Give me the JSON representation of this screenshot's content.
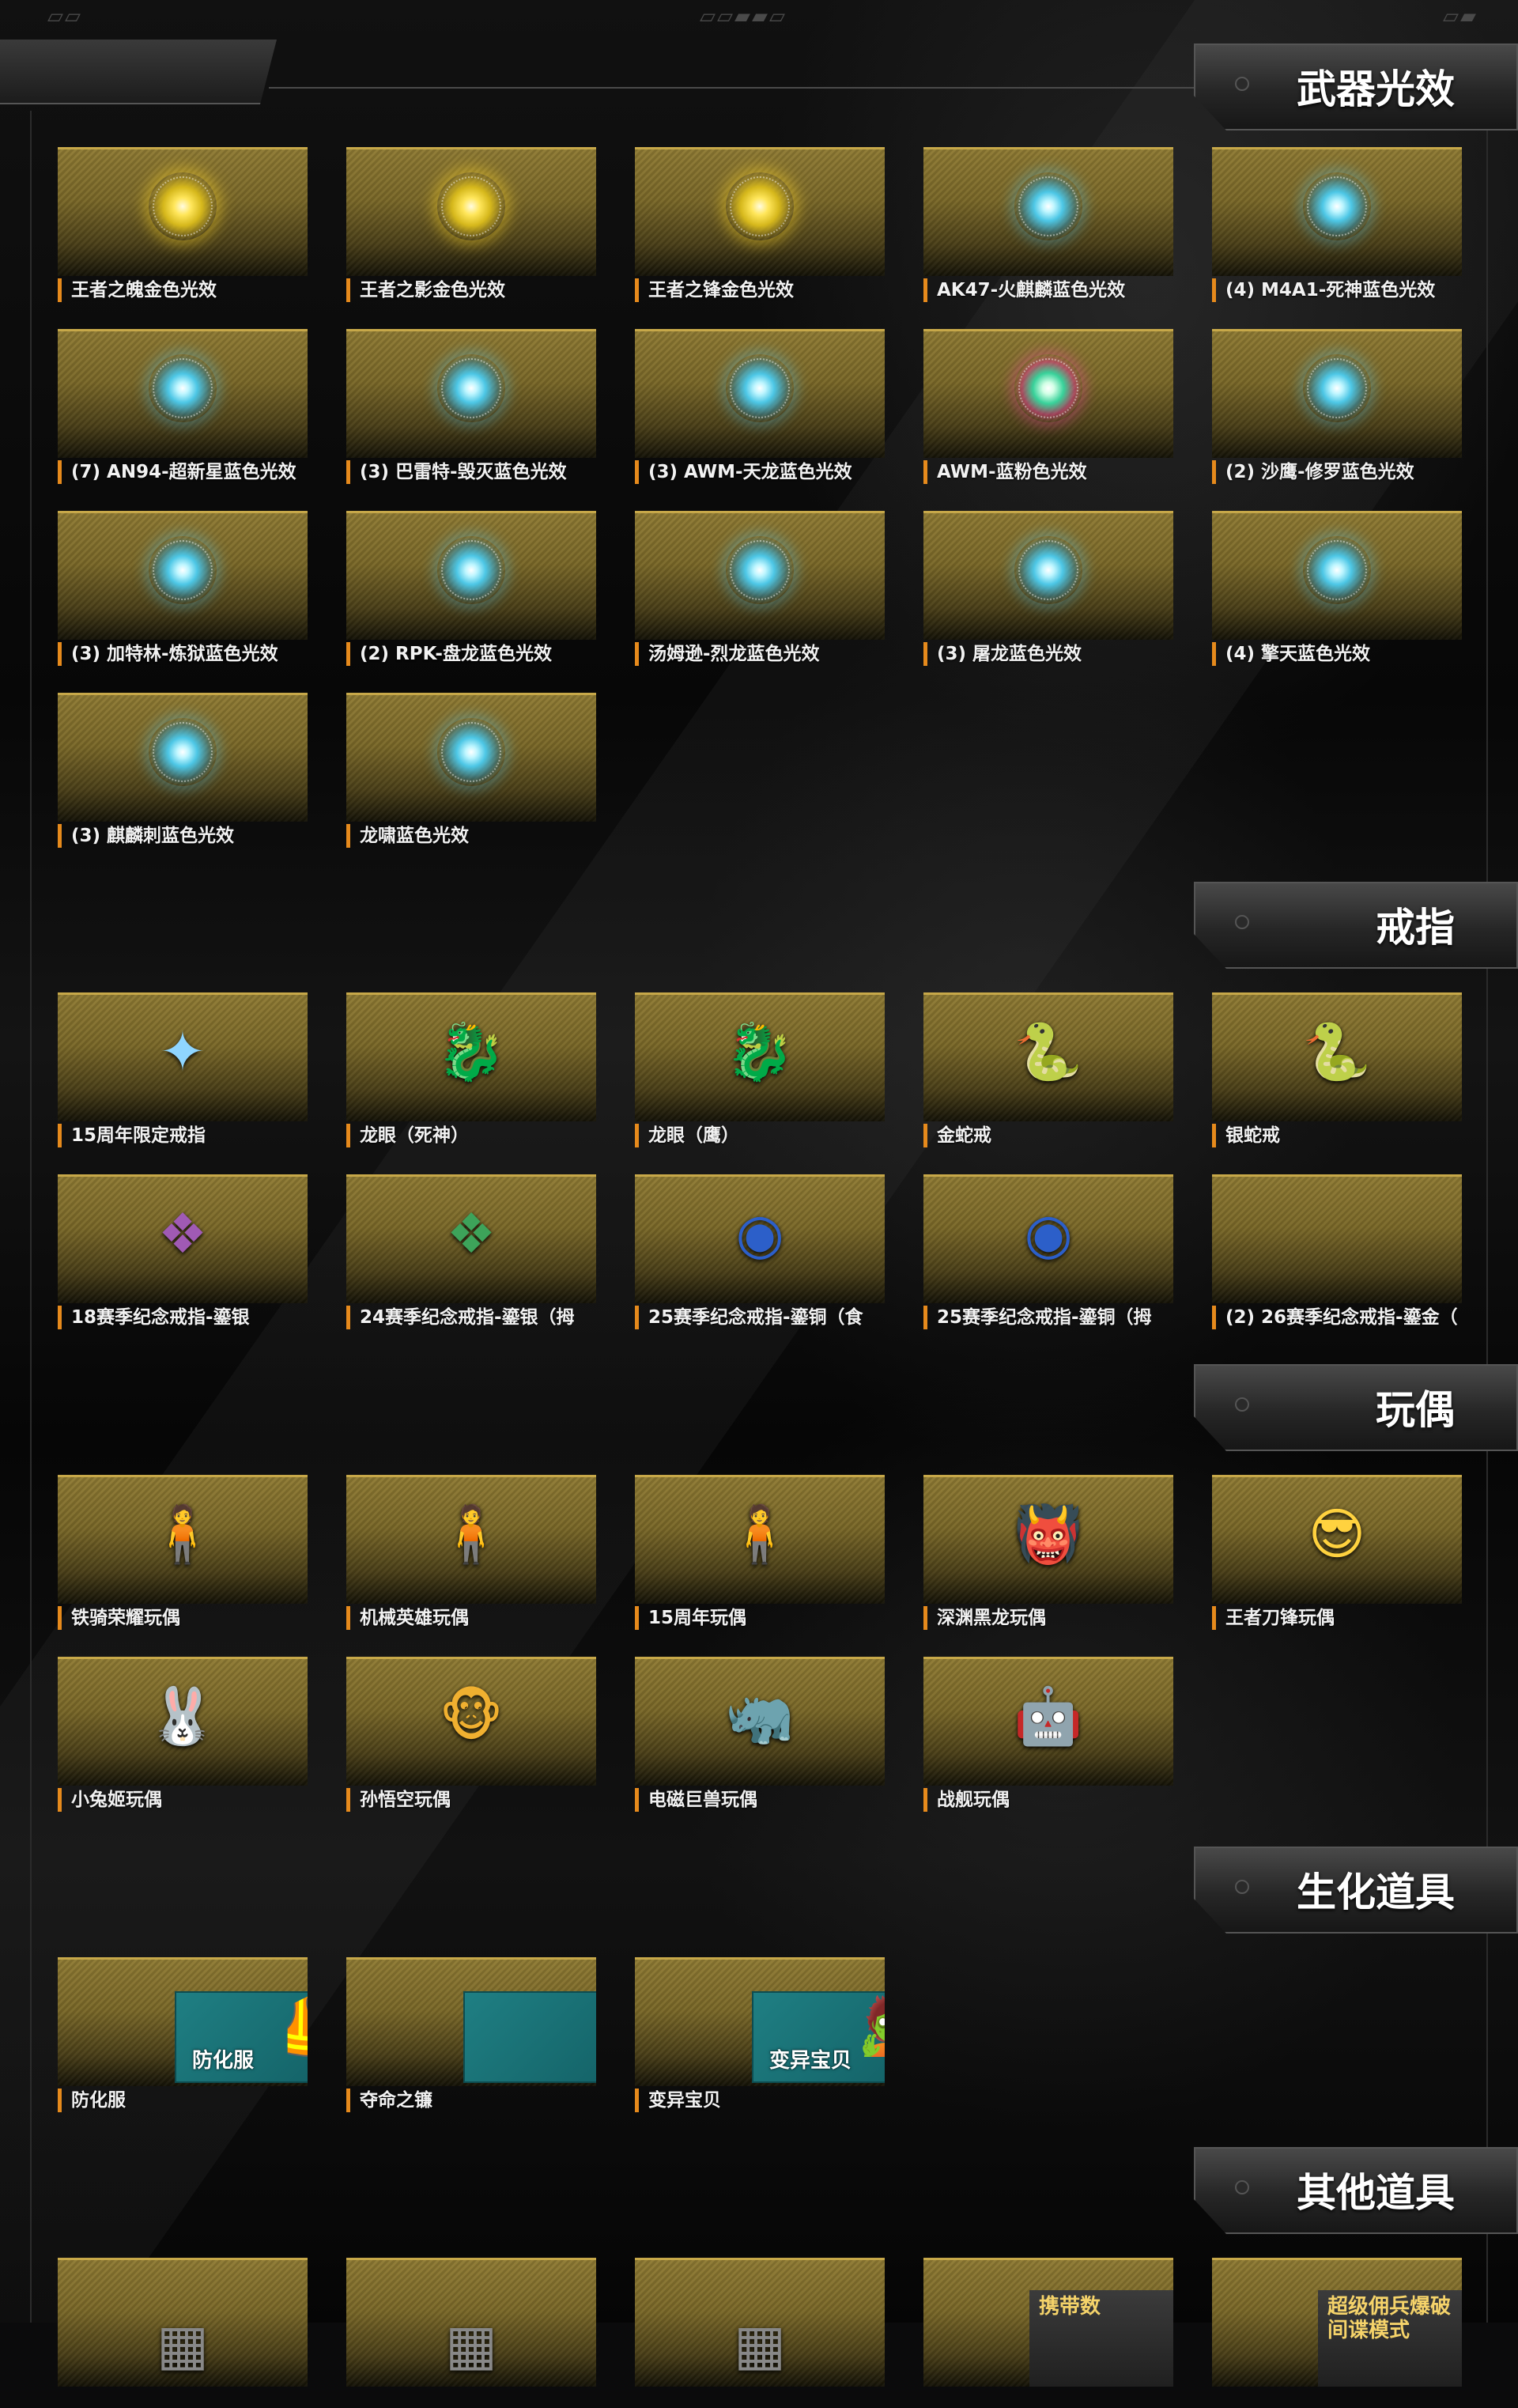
{
  "top_marks": {
    "left": "▱▱",
    "center": "▱▱▰▰▱",
    "right": "▱▰"
  },
  "sections": [
    {
      "id": "weapon-effects",
      "title": "武器光效",
      "items": [
        {
          "label": "王者之魄金色光效",
          "icon": "gold-glow-orb"
        },
        {
          "label": "王者之影金色光效",
          "icon": "gold-glow-orb"
        },
        {
          "label": "王者之锋金色光效",
          "icon": "gold-glow-orb"
        },
        {
          "label": "AK47-火麒麟蓝色光效",
          "icon": "blue-glow-orb"
        },
        {
          "label": "(4) M4A1-死神蓝色光效",
          "icon": "blue-glow-orb"
        },
        {
          "label": "(7) AN94-超新星蓝色光效",
          "icon": "blue-glow-orb"
        },
        {
          "label": "(3) 巴雷特-毁灭蓝色光效",
          "icon": "blue-glow-orb"
        },
        {
          "label": "(3) AWM-天龙蓝色光效",
          "icon": "blue-glow-orb"
        },
        {
          "label": "AWM-蓝粉色光效",
          "icon": "pink-glow-orb"
        },
        {
          "label": "(2) 沙鹰-修罗蓝色光效",
          "icon": "blue-glow-orb"
        },
        {
          "label": "(3) 加特林-炼狱蓝色光效",
          "icon": "blue-glow-orb"
        },
        {
          "label": "(2) RPK-盘龙蓝色光效",
          "icon": "blue-glow-orb"
        },
        {
          "label": "汤姆逊-烈龙蓝色光效",
          "icon": "blue-glow-orb"
        },
        {
          "label": "(3) 屠龙蓝色光效",
          "icon": "blue-glow-orb"
        },
        {
          "label": "(4) 擎天蓝色光效",
          "icon": "blue-glow-orb"
        },
        {
          "label": "(3) 麒麟刺蓝色光效",
          "icon": "blue-glow-orb"
        },
        {
          "label": "龙啸蓝色光效",
          "icon": "blue-glow-orb"
        }
      ]
    },
    {
      "id": "rings",
      "title": "戒指",
      "items": [
        {
          "label": "15周年限定戒指",
          "icon": "crystal-ring-icon",
          "glyph": "✦",
          "color": "#8fd6ff"
        },
        {
          "label": "龙眼（死神）",
          "icon": "gold-dragon-ring-icon",
          "glyph": "🐉",
          "color": "#e0b34a"
        },
        {
          "label": "龙眼（鹰）",
          "icon": "silver-dragon-ring-icon",
          "glyph": "🐉",
          "color": "#d8d8d8"
        },
        {
          "label": "金蛇戒",
          "icon": "gold-snake-ring-icon",
          "glyph": "🐍",
          "color": "#e0a030"
        },
        {
          "label": "银蛇戒",
          "icon": "silver-snake-ring-icon",
          "glyph": "🐍",
          "color": "#e6e6e6"
        },
        {
          "label": "18赛季纪念戒指-鎏银",
          "icon": "purple-ring-icon",
          "glyph": "❖",
          "color": "#a05ab4"
        },
        {
          "label": "24赛季纪念戒指-鎏银（拇",
          "icon": "green-ring-icon",
          "glyph": "❖",
          "color": "#3da35a"
        },
        {
          "label": "25赛季纪念戒指-鎏铜（食",
          "icon": "blue-gem-ring-icon",
          "glyph": "◉",
          "color": "#2c5fc9"
        },
        {
          "label": "25赛季纪念戒指-鎏铜（拇",
          "icon": "blue-gem-ring-icon",
          "glyph": "◉",
          "color": "#2c5fc9"
        },
        {
          "label": "(2) 26赛季纪念戒指-鎏金（",
          "icon": "empty-slot-icon",
          "glyph": "",
          "color": "#000"
        }
      ]
    },
    {
      "id": "dolls",
      "title": "玩偶",
      "items": [
        {
          "label": "铁骑荣耀玩偶",
          "icon": "doll-soldier-icon",
          "glyph": "🧍",
          "color": "#c0392b"
        },
        {
          "label": "机械英雄玩偶",
          "icon": "doll-mecha-hero-icon",
          "glyph": "🧍",
          "color": "#bbbbbb"
        },
        {
          "label": "15周年玩偶",
          "icon": "doll-pink-girl-icon",
          "glyph": "🧍",
          "color": "#ff8fb3"
        },
        {
          "label": "深渊黑龙玩偶",
          "icon": "doll-black-dragon-icon",
          "glyph": "👹",
          "color": "#b03030"
        },
        {
          "label": "王者刀锋玩偶",
          "icon": "doll-blonde-icon",
          "glyph": "😎",
          "color": "#ffd23f"
        },
        {
          "label": "小兔姬玩偶",
          "icon": "doll-bunny-girl-icon",
          "glyph": "🐰",
          "color": "#f2f2f2"
        },
        {
          "label": "孙悟空玩偶",
          "icon": "doll-monkey-king-icon",
          "glyph": "🐵",
          "color": "#f0b030"
        },
        {
          "label": "电磁巨兽玩偶",
          "icon": "doll-robot-beast-icon",
          "glyph": "🦏",
          "color": "#777777"
        },
        {
          "label": "战舰玩偶",
          "icon": "doll-battleship-icon",
          "glyph": "🤖",
          "color": "#555555"
        }
      ]
    },
    {
      "id": "bio-items",
      "title": "生化道具",
      "items": [
        {
          "label": "防化服",
          "icon": "hazmat-suit-banner-icon",
          "banner_text": "防化服",
          "glyph": "🦺"
        },
        {
          "label": "夺命之镰",
          "icon": "scythe-banner-icon",
          "banner_text": "",
          "glyph": "⸙"
        },
        {
          "label": "变异宝贝",
          "icon": "mutant-baby-banner-icon",
          "banner_text": "变异宝贝",
          "glyph": "🧟"
        }
      ]
    },
    {
      "id": "other-items",
      "title": "其他道具",
      "items": [
        {
          "label": "",
          "icon": "crate-icon"
        },
        {
          "label": "",
          "icon": "crate-icon"
        },
        {
          "label": "",
          "icon": "crate-icon"
        },
        {
          "label": "",
          "icon": "promo-icon",
          "promo_text": "携带数"
        },
        {
          "label": "",
          "icon": "promo-icon",
          "promo_text": "超级佣兵爆破\n间谍模式"
        }
      ]
    }
  ]
}
